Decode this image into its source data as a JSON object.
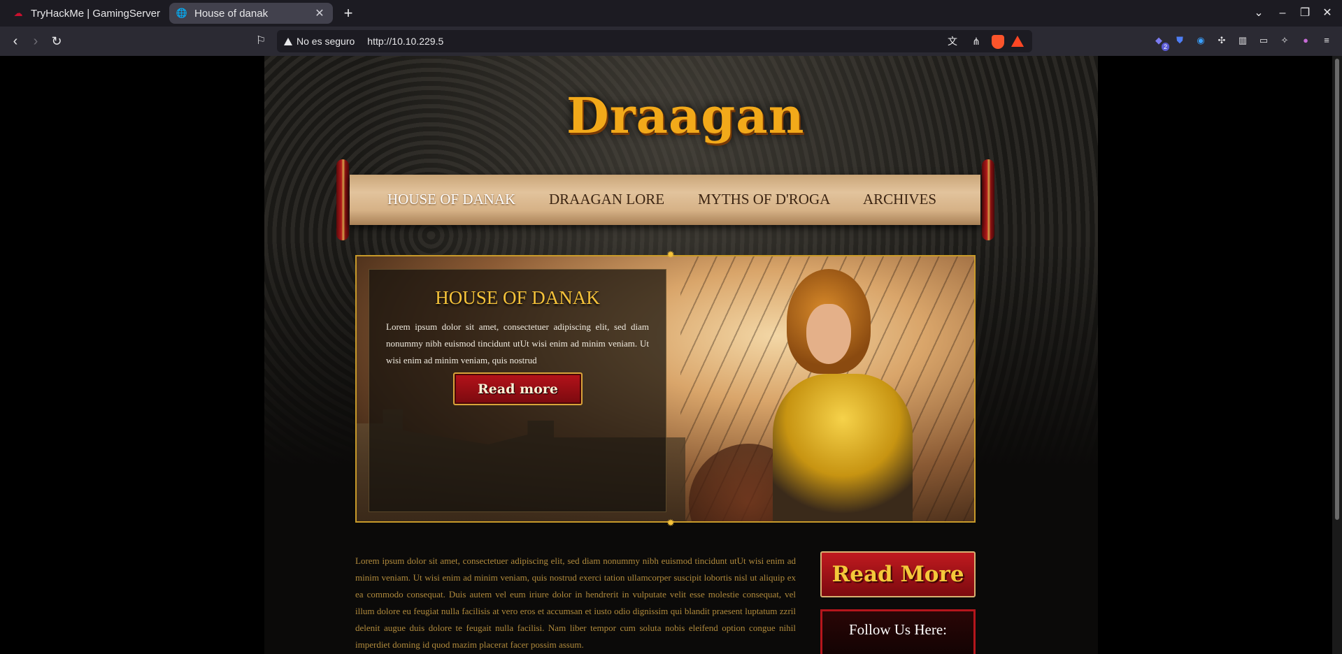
{
  "browser": {
    "tabs": [
      {
        "label": "TryHackMe | GamingServer",
        "icon": "tryhackme-icon",
        "active": false
      },
      {
        "label": "House of danak",
        "icon": "globe-icon",
        "active": true
      }
    ],
    "security_label": "No es seguro",
    "url": "http://10.10.229.5",
    "extension_badge": "2"
  },
  "site": {
    "logo": "Draagan",
    "nav": [
      "HOUSE OF DANAK",
      "DRAAGAN LORE",
      "MYTHS OF D'ROGA",
      "ARCHIVES"
    ],
    "hero": {
      "title": "HOUSE OF DANAK",
      "text": "Lorem ipsum dolor sit amet, consectetuer adipiscing elit, sed diam nonummy nibh euismod tincidunt utUt wisi enim ad minim veniam. Ut wisi enim ad minim veniam, quis nostrud",
      "button": "Read more"
    },
    "main_text": "Lorem ipsum dolor sit amet, consectetuer adipiscing elit, sed diam nonummy nibh euismod tincidunt utUt wisi enim ad minim veniam. Ut wisi enim ad minim veniam, quis nostrud exerci tation ullamcorper suscipit lobortis nisl ut aliquip ex ea commodo consequat. Duis autem vel eum iriure dolor in hendrerit in vulputate velit esse molestie consequat, vel illum dolore eu feugiat nulla facilisis at vero eros et accumsan et iusto odio dignissim qui blandit praesent luptatum zzril delenit augue duis dolore te feugait nulla facilisi. Nam liber tempor cum soluta nobis eleifend option congue nihil imperdiet doming id quod mazim placerat facer possim assum.",
    "sidebar_button": "Read More",
    "follow_title": "Follow Us Here:"
  },
  "colors": {
    "accent_gold": "#f5c23a",
    "button_red": "#b5121a",
    "text_gold": "#b08a3c"
  }
}
